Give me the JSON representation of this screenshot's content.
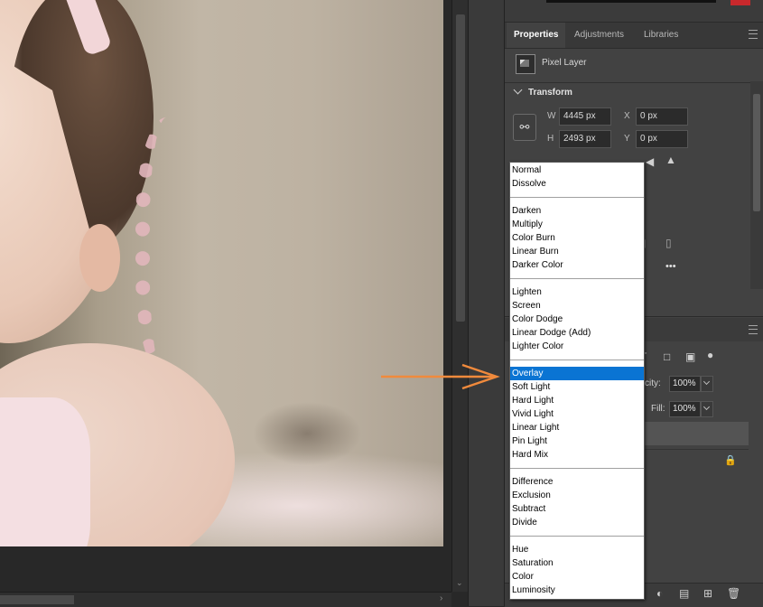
{
  "properties_panel": {
    "tabs": [
      "Properties",
      "Adjustments",
      "Libraries"
    ],
    "active_tab": "Properties",
    "layer_kind": "Pixel Layer",
    "transform": {
      "section_title": "Transform",
      "w_label": "W",
      "w_value": "4445 px",
      "h_label": "H",
      "h_value": "2493 px",
      "x_label": "X",
      "x_value": "0 px",
      "y_label": "Y",
      "y_value": "0 px"
    },
    "more_label": "•••"
  },
  "layers_panel": {
    "opacity_label": "city:",
    "opacity_value": "100%",
    "fill_label": "Fill:",
    "fill_value": "100%"
  },
  "blend_mode_menu": {
    "selected": "Overlay",
    "groups": [
      [
        "Normal",
        "Dissolve"
      ],
      [
        "Darken",
        "Multiply",
        "Color Burn",
        "Linear Burn",
        "Darker Color"
      ],
      [
        "Lighten",
        "Screen",
        "Color Dodge",
        "Linear Dodge (Add)",
        "Lighter Color"
      ],
      [
        "Overlay",
        "Soft Light",
        "Hard Light",
        "Vivid Light",
        "Linear Light",
        "Pin Light",
        "Hard Mix"
      ],
      [
        "Difference",
        "Exclusion",
        "Subtract",
        "Divide"
      ],
      [
        "Hue",
        "Saturation",
        "Color",
        "Luminosity"
      ]
    ]
  },
  "colors": {
    "selection_highlight": "#0a74d3",
    "annotation_arrow": "#f08a3c",
    "panel_background": "#424242"
  },
  "icons": {
    "link": "chain-link-icon",
    "pixel_layer": "pixel-layer-thumbnail-icon",
    "panel_menu": "hamburger-menu-icon"
  }
}
